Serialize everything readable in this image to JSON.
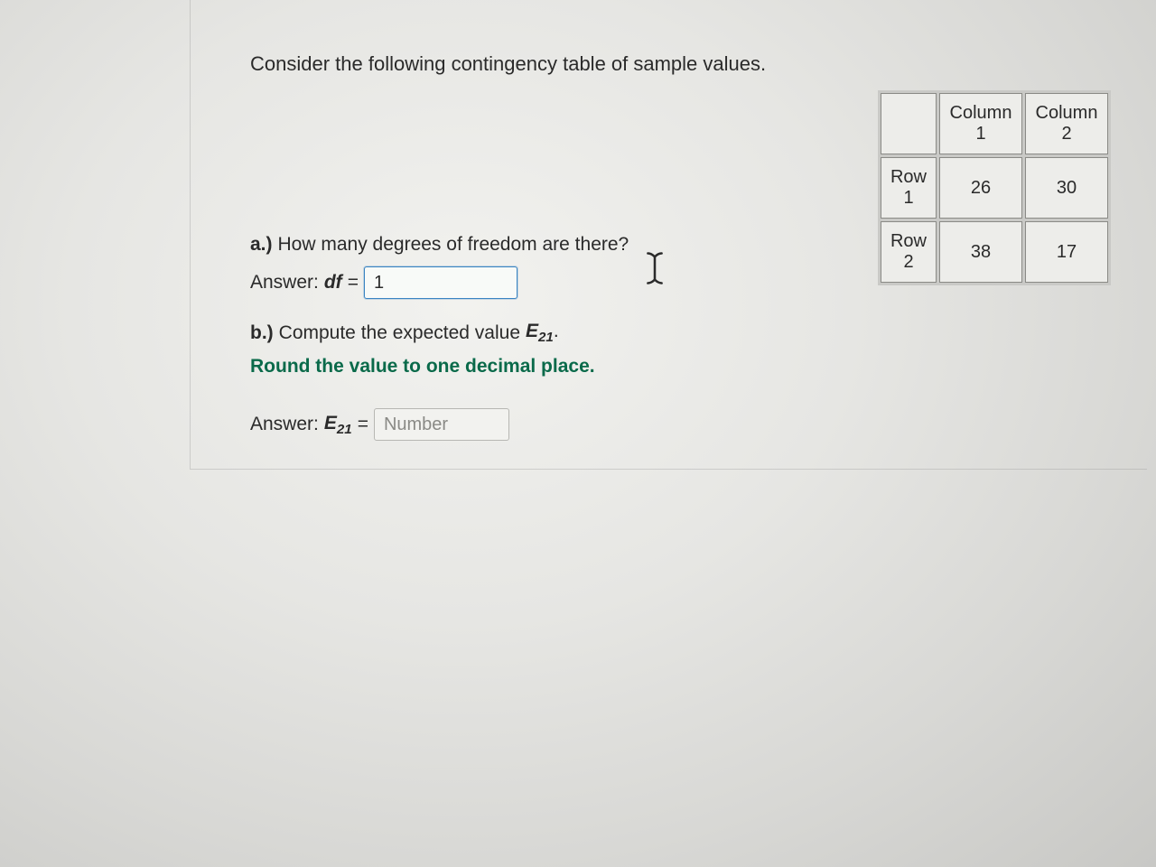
{
  "intro": "Consider the following contingency table of sample values.",
  "table": {
    "col_headers": [
      "Column 1",
      "Column 2"
    ],
    "row_headers": [
      "Row 1",
      "Row 2"
    ],
    "cells": [
      [
        26,
        30
      ],
      [
        38,
        17
      ]
    ]
  },
  "partA": {
    "label": "a.)",
    "question": "How many degrees of freedom are there?",
    "answer_prefix": "Answer:",
    "var": "df",
    "equals": "=",
    "value": "1"
  },
  "partB": {
    "label": "b.)",
    "question": "Compute the expected value",
    "var_base": "E",
    "var_sub": "21",
    "period": ".",
    "instruction": "Round the value to one decimal place.",
    "answer_prefix": "Answer:",
    "equals": "=",
    "placeholder": "Number"
  },
  "chart_data": {
    "type": "table",
    "title": "Contingency table of sample values",
    "columns": [
      "",
      "Column 1",
      "Column 2"
    ],
    "rows": [
      [
        "Row 1",
        26,
        30
      ],
      [
        "Row 2",
        38,
        17
      ]
    ]
  }
}
